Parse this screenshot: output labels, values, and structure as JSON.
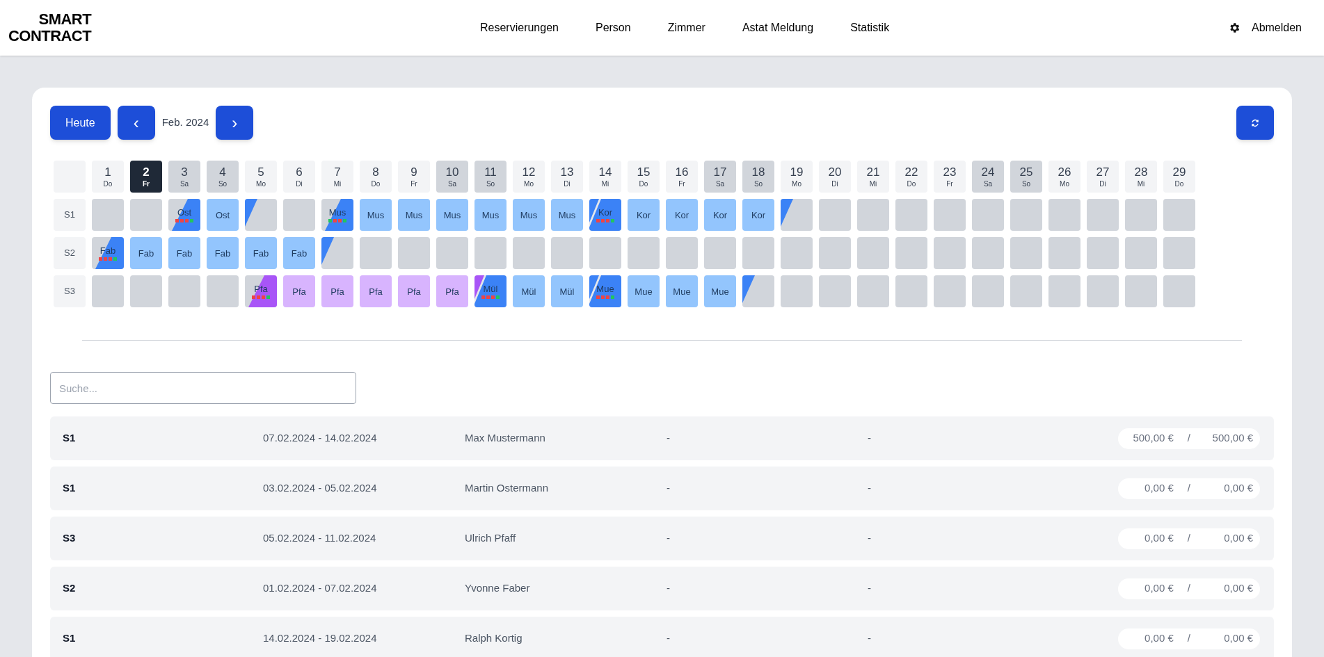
{
  "logo": {
    "line1": "SMART",
    "line2": "CONTRACT"
  },
  "nav": [
    {
      "label": "Reservierungen"
    },
    {
      "label": "Person"
    },
    {
      "label": "Zimmer"
    },
    {
      "label": "Astat Meldung"
    },
    {
      "label": "Statistik"
    }
  ],
  "logout": {
    "label": "Abmelden"
  },
  "toolbar": {
    "today": "Heute",
    "prev": "‹",
    "month": "Feb. 2024",
    "next": "›"
  },
  "days": [
    {
      "day": "1",
      "weekday": "Do",
      "weekend": false,
      "selected": false
    },
    {
      "day": "2",
      "weekday": "Fr",
      "weekend": false,
      "selected": true
    },
    {
      "day": "3",
      "weekday": "Sa",
      "weekend": true,
      "selected": false
    },
    {
      "day": "4",
      "weekday": "So",
      "weekend": true,
      "selected": false
    },
    {
      "day": "5",
      "weekday": "Mo",
      "weekend": false,
      "selected": false
    },
    {
      "day": "6",
      "weekday": "Di",
      "weekend": false,
      "selected": false
    },
    {
      "day": "7",
      "weekday": "Mi",
      "weekend": false,
      "selected": false
    },
    {
      "day": "8",
      "weekday": "Do",
      "weekend": false,
      "selected": false
    },
    {
      "day": "9",
      "weekday": "Fr",
      "weekend": false,
      "selected": false
    },
    {
      "day": "10",
      "weekday": "Sa",
      "weekend": true,
      "selected": false
    },
    {
      "day": "11",
      "weekday": "So",
      "weekend": true,
      "selected": false
    },
    {
      "day": "12",
      "weekday": "Mo",
      "weekend": false,
      "selected": false
    },
    {
      "day": "13",
      "weekday": "Di",
      "weekend": false,
      "selected": false
    },
    {
      "day": "14",
      "weekday": "Mi",
      "weekend": false,
      "selected": false
    },
    {
      "day": "15",
      "weekday": "Do",
      "weekend": false,
      "selected": false
    },
    {
      "day": "16",
      "weekday": "Fr",
      "weekend": false,
      "selected": false
    },
    {
      "day": "17",
      "weekday": "Sa",
      "weekend": true,
      "selected": false
    },
    {
      "day": "18",
      "weekday": "So",
      "weekend": true,
      "selected": false
    },
    {
      "day": "19",
      "weekday": "Mo",
      "weekend": false,
      "selected": false
    },
    {
      "day": "20",
      "weekday": "Di",
      "weekend": false,
      "selected": false
    },
    {
      "day": "21",
      "weekday": "Mi",
      "weekend": false,
      "selected": false
    },
    {
      "day": "22",
      "weekday": "Do",
      "weekend": false,
      "selected": false
    },
    {
      "day": "23",
      "weekday": "Fr",
      "weekend": false,
      "selected": false
    },
    {
      "day": "24",
      "weekday": "Sa",
      "weekend": true,
      "selected": false
    },
    {
      "day": "25",
      "weekday": "So",
      "weekend": true,
      "selected": false
    },
    {
      "day": "26",
      "weekday": "Mo",
      "weekend": false,
      "selected": false
    },
    {
      "day": "27",
      "weekday": "Di",
      "weekend": false,
      "selected": false
    },
    {
      "day": "28",
      "weekday": "Mi",
      "weekend": false,
      "selected": false
    },
    {
      "day": "29",
      "weekday": "Do",
      "weekend": false,
      "selected": false
    }
  ],
  "rooms": [
    {
      "name": "S1",
      "cells": [
        {
          "kind": "empty"
        },
        {
          "kind": "empty"
        },
        {
          "kind": "start",
          "label": "Ost",
          "color": "#3b82f6",
          "dots": [
            {
              "color": "#ef4444"
            },
            {
              "color": "#ef4444"
            },
            {
              "color": "#ef4444"
            },
            {
              "color": "#22c55e"
            }
          ]
        },
        {
          "kind": "booked",
          "label": "Ost",
          "color": "#93c5fd"
        },
        {
          "kind": "end",
          "color": "#3b82f6"
        },
        {
          "kind": "empty"
        },
        {
          "kind": "start",
          "label": "Mus",
          "color": "#3b82f6",
          "dots": [
            {
              "color": "#22c55e"
            },
            {
              "color": "#ef4444"
            },
            {
              "color": "#ef4444"
            },
            {
              "color": "#22c55e"
            }
          ]
        },
        {
          "kind": "booked",
          "label": "Mus",
          "color": "#93c5fd"
        },
        {
          "kind": "booked",
          "label": "Mus",
          "color": "#93c5fd"
        },
        {
          "kind": "booked",
          "label": "Mus",
          "color": "#93c5fd"
        },
        {
          "kind": "booked",
          "label": "Mus",
          "color": "#93c5fd"
        },
        {
          "kind": "booked",
          "label": "Mus",
          "color": "#93c5fd"
        },
        {
          "kind": "booked",
          "label": "Mus",
          "color": "#93c5fd"
        },
        {
          "kind": "changeover",
          "label": "Kor",
          "color": "#3b82f6",
          "previous_booking": {
            "color": "#3b82f6"
          },
          "dots": [
            {
              "color": "#ef4444"
            },
            {
              "color": "#ef4444"
            },
            {
              "color": "#ef4444"
            },
            {
              "color": "#22c55e"
            }
          ]
        },
        {
          "kind": "booked",
          "label": "Kor",
          "color": "#93c5fd"
        },
        {
          "kind": "booked",
          "label": "Kor",
          "color": "#93c5fd"
        },
        {
          "kind": "booked",
          "label": "Kor",
          "color": "#93c5fd"
        },
        {
          "kind": "booked",
          "label": "Kor",
          "color": "#93c5fd"
        },
        {
          "kind": "end",
          "color": "#3b82f6"
        },
        {
          "kind": "empty"
        },
        {
          "kind": "empty"
        },
        {
          "kind": "empty"
        },
        {
          "kind": "empty"
        },
        {
          "kind": "empty"
        },
        {
          "kind": "empty"
        },
        {
          "kind": "empty"
        },
        {
          "kind": "empty"
        },
        {
          "kind": "empty"
        },
        {
          "kind": "empty"
        }
      ]
    },
    {
      "name": "S2",
      "cells": [
        {
          "kind": "start",
          "label": "Fab",
          "color": "#3b82f6",
          "dots": [
            {
              "color": "#ef4444"
            },
            {
              "color": "#ef4444"
            },
            {
              "color": "#ef4444"
            },
            {
              "color": "#22c55e"
            }
          ]
        },
        {
          "kind": "booked",
          "label": "Fab",
          "color": "#93c5fd"
        },
        {
          "kind": "booked",
          "label": "Fab",
          "color": "#93c5fd"
        },
        {
          "kind": "booked",
          "label": "Fab",
          "color": "#93c5fd"
        },
        {
          "kind": "booked",
          "label": "Fab",
          "color": "#93c5fd"
        },
        {
          "kind": "booked",
          "label": "Fab",
          "color": "#93c5fd"
        },
        {
          "kind": "end",
          "color": "#3b82f6"
        },
        {
          "kind": "empty"
        },
        {
          "kind": "empty"
        },
        {
          "kind": "empty"
        },
        {
          "kind": "empty"
        },
        {
          "kind": "empty"
        },
        {
          "kind": "empty"
        },
        {
          "kind": "empty"
        },
        {
          "kind": "empty"
        },
        {
          "kind": "empty"
        },
        {
          "kind": "empty"
        },
        {
          "kind": "empty"
        },
        {
          "kind": "empty"
        },
        {
          "kind": "empty"
        },
        {
          "kind": "empty"
        },
        {
          "kind": "empty"
        },
        {
          "kind": "empty"
        },
        {
          "kind": "empty"
        },
        {
          "kind": "empty"
        },
        {
          "kind": "empty"
        },
        {
          "kind": "empty"
        },
        {
          "kind": "empty"
        },
        {
          "kind": "empty"
        }
      ]
    },
    {
      "name": "S3",
      "cells": [
        {
          "kind": "empty"
        },
        {
          "kind": "empty"
        },
        {
          "kind": "empty"
        },
        {
          "kind": "empty"
        },
        {
          "kind": "start",
          "label": "Pfa",
          "color": "#a855f7",
          "dots": [
            {
              "color": "#ef4444"
            },
            {
              "color": "#ef4444"
            },
            {
              "color": "#ef4444"
            },
            {
              "color": "#22c55e"
            }
          ]
        },
        {
          "kind": "booked",
          "label": "Pfa",
          "color": "#d8b4fe"
        },
        {
          "kind": "booked",
          "label": "Pfa",
          "color": "#d8b4fe"
        },
        {
          "kind": "booked",
          "label": "Pfa",
          "color": "#d8b4fe"
        },
        {
          "kind": "booked",
          "label": "Pfa",
          "color": "#d8b4fe"
        },
        {
          "kind": "booked",
          "label": "Pfa",
          "color": "#d8b4fe"
        },
        {
          "kind": "changeover",
          "label": "Mül",
          "color": "#3b82f6",
          "previous_booking": {
            "color": "#a855f7"
          },
          "dots": [
            {
              "color": "#ef4444"
            },
            {
              "color": "#ef4444"
            },
            {
              "color": "#ef4444"
            },
            {
              "color": "#22c55e"
            }
          ]
        },
        {
          "kind": "booked",
          "label": "Mül",
          "color": "#93c5fd"
        },
        {
          "kind": "booked",
          "label": "Mül",
          "color": "#93c5fd"
        },
        {
          "kind": "changeover",
          "label": "Mue",
          "color": "#3b82f6",
          "previous_booking": {
            "color": "#3b82f6"
          },
          "dots": [
            {
              "color": "#ef4444"
            },
            {
              "color": "#ef4444"
            },
            {
              "color": "#ef4444"
            },
            {
              "color": "#22c55e"
            }
          ]
        },
        {
          "kind": "booked",
          "label": "Mue",
          "color": "#93c5fd"
        },
        {
          "kind": "booked",
          "label": "Mue",
          "color": "#93c5fd"
        },
        {
          "kind": "booked",
          "label": "Mue",
          "color": "#93c5fd"
        },
        {
          "kind": "end",
          "color": "#3b82f6"
        },
        {
          "kind": "empty"
        },
        {
          "kind": "empty"
        },
        {
          "kind": "empty"
        },
        {
          "kind": "empty"
        },
        {
          "kind": "empty"
        },
        {
          "kind": "empty"
        },
        {
          "kind": "empty"
        },
        {
          "kind": "empty"
        },
        {
          "kind": "empty"
        },
        {
          "kind": "empty"
        },
        {
          "kind": "empty"
        }
      ]
    }
  ],
  "search": {
    "placeholder": "Suche..."
  },
  "reservations": [
    {
      "room": "S1",
      "period": "07.02.2024 - 14.02.2024",
      "guest": "Max Mustermann",
      "column_4": "-",
      "column_5": "-",
      "paid": "500,00 €",
      "separator": "/",
      "total": "500,00 €"
    },
    {
      "room": "S1",
      "period": "03.02.2024 - 05.02.2024",
      "guest": "Martin Ostermann",
      "column_4": "-",
      "column_5": "-",
      "paid": "0,00 €",
      "separator": "/",
      "total": "0,00 €"
    },
    {
      "room": "S3",
      "period": "05.02.2024 - 11.02.2024",
      "guest": "Ulrich Pfaff",
      "column_4": "-",
      "column_5": "-",
      "paid": "0,00 €",
      "separator": "/",
      "total": "0,00 €"
    },
    {
      "room": "S2",
      "period": "01.02.2024 - 07.02.2024",
      "guest": "Yvonne Faber",
      "column_4": "-",
      "column_5": "-",
      "paid": "0,00 €",
      "separator": "/",
      "total": "0,00 €"
    },
    {
      "room": "S1",
      "period": "14.02.2024 - 19.02.2024",
      "guest": "Ralph Kortig",
      "column_4": "-",
      "column_5": "-",
      "paid": "0,00 €",
      "separator": "/",
      "total": "0,00 €"
    }
  ]
}
